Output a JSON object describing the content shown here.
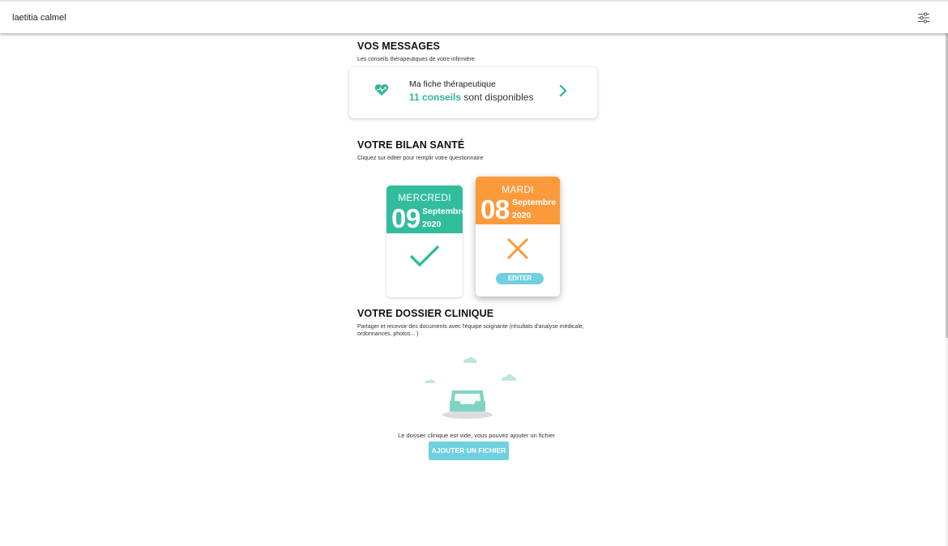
{
  "header": {
    "user_name": "laetitia calmel",
    "settings_icon": "sliders-icon"
  },
  "messages": {
    "title": "VOS MESSAGES",
    "subtitle": "Les conseils thérapeutiques de votre infirmière",
    "card": {
      "icon": "heart-plus-icon",
      "title": "Ma fiche thérapeutique",
      "count": "11 conseils",
      "suffix": " sont disponibles",
      "chevron_icon": "chevron-right-icon"
    }
  },
  "bilan": {
    "title": "VOTRE BILAN SANTÉ",
    "subtitle": "Cliquez sur éditer pour remplir votre questionnaire",
    "days": [
      {
        "day_of_week": "MERCREDI",
        "day_number": "09",
        "month": "Septembre",
        "year": "2020",
        "status": "done",
        "status_icon": "check-icon",
        "color": "#31bd9d"
      },
      {
        "day_of_week": "MARDI",
        "day_number": "08",
        "month": "Septembre",
        "year": "2020",
        "status": "missing",
        "status_icon": "cross-icon",
        "color": "#fb9a3b",
        "button_label": "EDITER"
      }
    ]
  },
  "dossier": {
    "title": "VOTRE DOSSIER CLINIQUE",
    "subtitle": "Partager et recevoir des documents avec l'équipe soignante (résultats d'analyse médicale, ordonnances, photos... )",
    "illustration_icon": "empty-inbox-illustration",
    "empty_message": "Le dossier clinique est vide, vous pouvez ajouter un fichier",
    "add_button": "AJOUTER UN FICHIER"
  },
  "colors": {
    "teal": "#2fb59a",
    "green_header": "#31bd9d",
    "orange_header": "#fb9a3b",
    "button_blue": "#6fd0e0"
  }
}
